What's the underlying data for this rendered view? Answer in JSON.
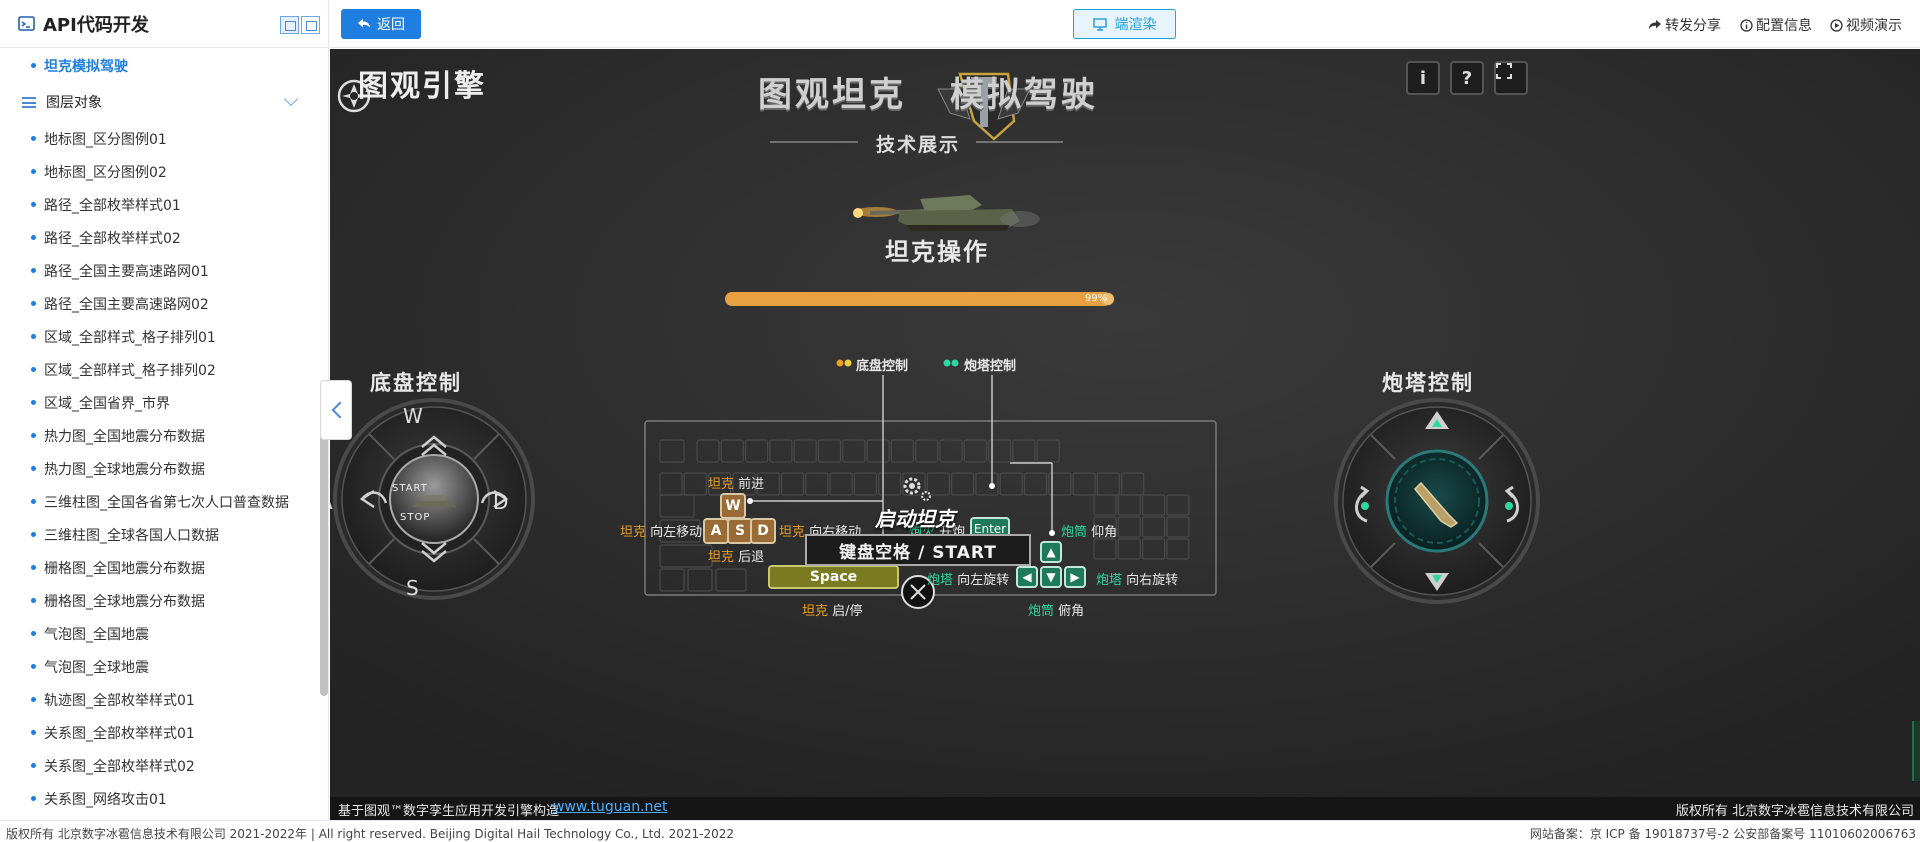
{
  "sidebar": {
    "title": "API代码开发",
    "active_item": "坦克模拟驾驶",
    "group_label": "图层对象",
    "items": [
      "地标图_区分图例01",
      "地标图_区分图例02",
      "路径_全部枚举样式01",
      "路径_全部枚举样式02",
      "路径_全国主要高速路网01",
      "路径_全国主要高速路网02",
      "区域_全部样式_格子排列01",
      "区域_全部样式_格子排列02",
      "区域_全国省界_市界",
      "热力图_全国地震分布数据",
      "热力图_全球地震分布数据",
      "三维柱图_全国各省第七次人口普查数据",
      "三维柱图_全球各国人口数据",
      "栅格图_全国地震分布数据",
      "栅格图_全球地震分布数据",
      "气泡图_全国地震",
      "气泡图_全球地震",
      "轨迹图_全部枚举样式01",
      "关系图_全部枚举样式01",
      "关系图_全部枚举样式02",
      "关系图_网络攻击01"
    ]
  },
  "topbar": {
    "back_label": "返回",
    "render_label": "端渲染",
    "share_label": "转发分享",
    "config_label": "配置信息",
    "video_label": "视频演示"
  },
  "stage": {
    "logo_text": "图观引擎",
    "title_left": "图观坦克",
    "title_right": "模拟驾驶",
    "subtitle": "技术展示",
    "section_title": "坦克操作",
    "progress": {
      "percent": 99,
      "label": "99%"
    },
    "icon_info": "i",
    "icon_help": "?",
    "chassis_title": "底盘控制",
    "turret_title": "炮塔控制",
    "legend_chassis": "底盘控制",
    "legend_turret": "炮塔控制",
    "dpad": {
      "w": "W",
      "a": "A",
      "s": "S",
      "d": "D",
      "start": "START",
      "stop": "STOP"
    },
    "keys": {
      "w": "W",
      "a": "A",
      "s": "S",
      "d": "D",
      "enter": "Enter",
      "space": "Space"
    },
    "labels": {
      "tank": "坦克",
      "forward": "前进",
      "left_move": "向左移动",
      "right_move": "向右移动",
      "backward": "后退",
      "start_stop": "启/停",
      "turret": "炮塔",
      "rotate_left": "向左旋转",
      "rotate_right": "向右旋转",
      "barrel": "炮筒",
      "elevate": "仰角",
      "depress": "俯角",
      "fire_prefix": "炮火",
      "fire": "开炮"
    },
    "start_tank": "启动坦克",
    "start_hint": "键盘空格 / START",
    "footer_left": "基于图观™数字孪生应用开发引擎构造",
    "footer_link": "www.tuguan.net",
    "footer_right": "版权所有 北京数字冰雹信息技术有限公司"
  },
  "bottombar": {
    "left": "版权所有 北京数字冰雹信息技术有限公司 2021-2022年 | All right reserved. Beijing Digital Hail Technology Co., Ltd. 2021-2022",
    "right": "网站备案：京 ICP 备 19018737号-2 公安部备案号 11010602006763"
  },
  "colors": {
    "accent": "#1e7fe0",
    "chassis": "#f0a020",
    "turret": "#2ed6a0",
    "progress": "#e8a040"
  }
}
